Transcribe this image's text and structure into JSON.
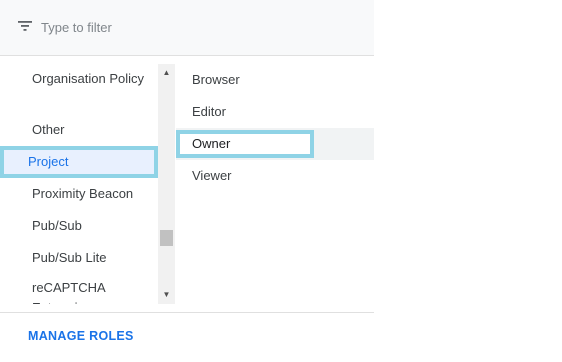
{
  "filter": {
    "placeholder": "Type to filter",
    "icon": "filter-icon"
  },
  "services": {
    "items": [
      {
        "label": "Organisation Policy"
      },
      {
        "label": "Other"
      },
      {
        "label": "Project",
        "selected": true
      },
      {
        "label": "Proximity Beacon"
      },
      {
        "label": "Pub/Sub"
      },
      {
        "label": "Pub/Sub Lite"
      },
      {
        "label": "reCAPTCHA Enterprise"
      }
    ]
  },
  "roles": {
    "items": [
      {
        "label": "Browser"
      },
      {
        "label": "Editor"
      },
      {
        "label": "Owner",
        "hovered": true
      },
      {
        "label": "Viewer"
      }
    ]
  },
  "footer": {
    "manage_roles_label": "MANAGE ROLES"
  },
  "colors": {
    "accent": "#1a73e8",
    "selected_bg": "#e8f0fe",
    "highlight": "#8fd3e6"
  }
}
